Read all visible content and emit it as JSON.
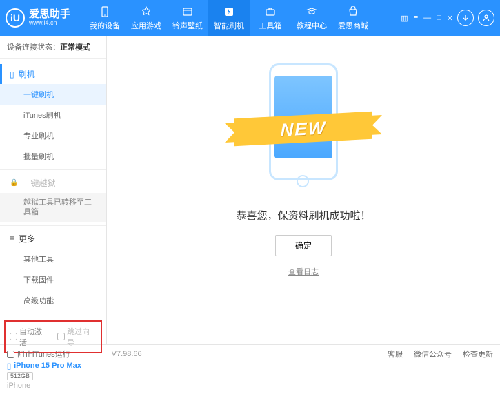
{
  "logo": {
    "title": "爱思助手",
    "url": "www.i4.cn",
    "glyph": "iU"
  },
  "nav": [
    {
      "label": "我的设备"
    },
    {
      "label": "应用游戏"
    },
    {
      "label": "铃声壁纸"
    },
    {
      "label": "智能刷机"
    },
    {
      "label": "工具箱"
    },
    {
      "label": "教程中心"
    },
    {
      "label": "爱思商城"
    }
  ],
  "status": {
    "label": "设备连接状态：",
    "value": "正常模式"
  },
  "sidebar": {
    "flash": {
      "header": "刷机",
      "items": [
        "一键刷机",
        "iTunes刷机",
        "专业刷机",
        "批量刷机"
      ]
    },
    "jailbreak": {
      "header": "一键越狱",
      "note": "越狱工具已转移至工具箱"
    },
    "more": {
      "header": "更多",
      "items": [
        "其他工具",
        "下载固件",
        "高级功能"
      ]
    }
  },
  "checkboxes": {
    "auto_activate": "自动激活",
    "skip_guide": "跳过向导"
  },
  "device": {
    "name": "iPhone 15 Pro Max",
    "storage": "512GB",
    "type": "iPhone"
  },
  "main": {
    "new_badge": "NEW",
    "success": "恭喜您，保资料刷机成功啦！",
    "confirm": "确定",
    "view_log": "查看日志"
  },
  "footer": {
    "block_itunes": "阻止iTunes运行",
    "version": "V7.98.66",
    "links": [
      "客服",
      "微信公众号",
      "检查更新"
    ]
  }
}
